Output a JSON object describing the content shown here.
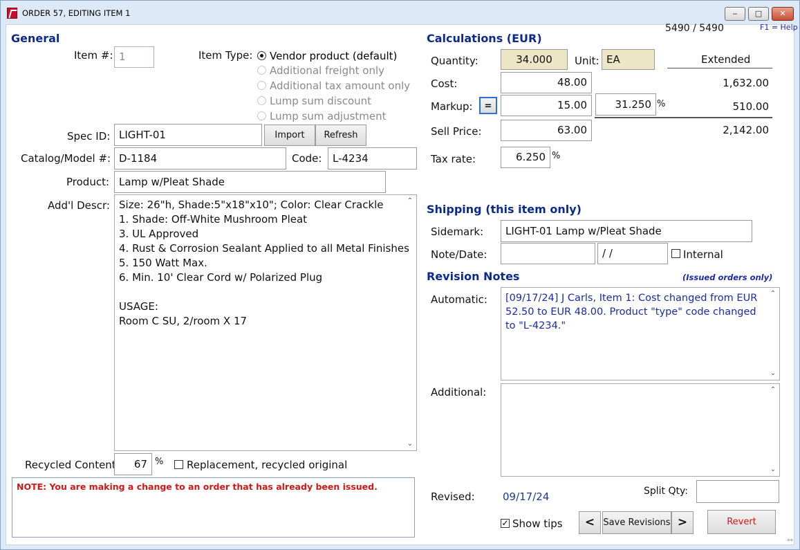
{
  "window": {
    "title": "ORDER 57,  EDITING ITEM 1",
    "minimize_glyph": "‒",
    "maximize_glyph": "□",
    "close_glyph": "✕"
  },
  "header": {
    "record_counter": "5490 / 5490",
    "help_hint": "F1 = Help"
  },
  "general": {
    "heading": "General",
    "item_number_label": "Item #:",
    "item_number_value": "1",
    "item_type_label": "Item Type:",
    "item_types": [
      {
        "label": "Vendor product (default)",
        "selected": true
      },
      {
        "label": "Additional freight only",
        "selected": false
      },
      {
        "label": "Additional tax amount only",
        "selected": false
      },
      {
        "label": "Lump sum discount",
        "selected": false
      },
      {
        "label": "Lump sum adjustment",
        "selected": false
      }
    ],
    "spec_id_label": "Spec ID:",
    "spec_id_value": "LIGHT-01",
    "import_button": "Import",
    "refresh_button": "Refresh",
    "catalog_label": "Catalog/Model #:",
    "catalog_value": "D-1184",
    "code_label": "Code:",
    "code_value": "L-4234",
    "product_label": "Product:",
    "product_value": "Lamp w/Pleat Shade",
    "addl_descr_label": "Add'l Descr:",
    "addl_descr_lines": [
      "Size: 26\"h, Shade:5\"x18\"x10\"; Color: Clear Crackle",
      "1. Shade: Off-White Mushroom Pleat",
      "3. UL Approved",
      "4. Rust & Corrosion Sealant Applied to all Metal Finishes",
      "5. 150 Watt Max.",
      "6. Min. 10' Clear Cord w/ Polarized Plug",
      "",
      "USAGE:",
      "Room C SU, 2/room X 17"
    ],
    "recycled_label": "Recycled Content:",
    "recycled_value": "67",
    "recycled_unit": "%",
    "replacement_label": "Replacement, recycled original",
    "replacement_checked": false,
    "note_text": "NOTE: You are making a change to an order that has already been issued."
  },
  "calculations": {
    "heading": "Calculations (EUR)",
    "quantity_label": "Quantity:",
    "quantity_value": "34.000",
    "unit_label": "Unit:",
    "unit_value": "EA",
    "extended_label": "Extended",
    "cost_label": "Cost:",
    "cost_value": "48.00",
    "cost_extended": "1,632.00",
    "markup_label": "Markup:",
    "markup_eq_button": "=",
    "markup_value": "15.00",
    "markup_percent": "31.250",
    "markup_percent_sign": "%",
    "markup_extended": "510.00",
    "sell_label": "Sell Price:",
    "sell_value": "63.00",
    "sell_extended": "2,142.00",
    "tax_label": "Tax rate:",
    "tax_value": "6.250",
    "tax_percent_sign": "%"
  },
  "shipping": {
    "heading": "Shipping (this item only)",
    "sidemark_label": "Sidemark:",
    "sidemark_value": "LIGHT-01 Lamp w/Pleat Shade",
    "note_date_label": "Note/Date:",
    "note_value": "",
    "date_value": " /  /",
    "internal_label": "Internal",
    "internal_checked": false
  },
  "revisions": {
    "heading": "Revision Notes",
    "issued_hint": "(Issued orders only)",
    "automatic_label": "Automatic:",
    "automatic_text": "[09/17/24]  J Carls, Item 1:  Cost changed from EUR 52.50 to EUR 48.00. Product \"type\" code changed to \"L-4234.\"",
    "additional_label": "Additional:",
    "additional_text": "",
    "revised_label": "Revised:",
    "revised_value": "09/17/24",
    "split_qty_label": "Split Qty:",
    "split_qty_value": ""
  },
  "footer": {
    "show_tips_label": "Show tips",
    "show_tips_checked": true,
    "prev_button": "<",
    "save_button": "Save Revisions",
    "next_button": ">",
    "revert_button": "Revert"
  }
}
